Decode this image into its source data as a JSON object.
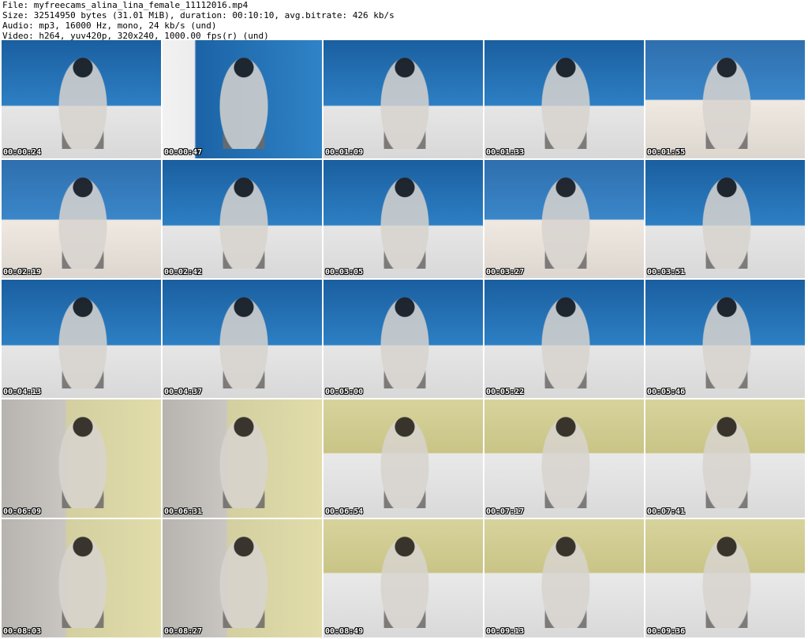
{
  "header": {
    "file_line": "File: myfreecams_alina_lina_female_11112016.mp4",
    "size_line": "Size: 32514950 bytes (31.01 MiB), duration: 00:10:10, avg.bitrate: 426 kb/s",
    "audio_line": "Audio: mp3, 16000 Hz, mono, 24 kb/s (und)",
    "video_line": "Video: h264, yuv420p, 320x240, 1000.00 fps(r) (und)"
  },
  "thumbnails": [
    {
      "timestamp": "00:00:24"
    },
    {
      "timestamp": "00:00:47"
    },
    {
      "timestamp": "00:01:09"
    },
    {
      "timestamp": "00:01:33"
    },
    {
      "timestamp": "00:01:55"
    },
    {
      "timestamp": "00:02:19"
    },
    {
      "timestamp": "00:02:42"
    },
    {
      "timestamp": "00:03:05"
    },
    {
      "timestamp": "00:03:27"
    },
    {
      "timestamp": "00:03:51"
    },
    {
      "timestamp": "00:04:13"
    },
    {
      "timestamp": "00:04:37"
    },
    {
      "timestamp": "00:05:00"
    },
    {
      "timestamp": "00:05:22"
    },
    {
      "timestamp": "00:05:46"
    },
    {
      "timestamp": "00:06:09"
    },
    {
      "timestamp": "00:06:31"
    },
    {
      "timestamp": "00:06:54"
    },
    {
      "timestamp": "00:07:17"
    },
    {
      "timestamp": "00:07:41"
    },
    {
      "timestamp": "00:08:03"
    },
    {
      "timestamp": "00:08:27"
    },
    {
      "timestamp": "00:08:49"
    },
    {
      "timestamp": "00:09:13"
    },
    {
      "timestamp": "00:09:36"
    }
  ]
}
